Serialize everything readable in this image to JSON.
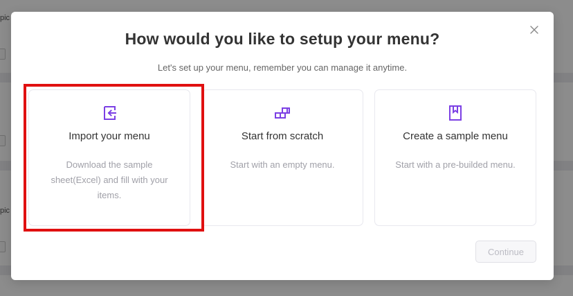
{
  "modal": {
    "title": "How would you like to setup your menu?",
    "subtitle": "Let's set up your menu, remember you can manage it anytime.",
    "close_icon": "close-icon",
    "options": [
      {
        "icon": "import-icon",
        "title": "Import your menu",
        "description": "Download the sample sheet(Excel) and fill with your items."
      },
      {
        "icon": "blocks-icon",
        "title": "Start from scratch",
        "description": "Start with an empty menu."
      },
      {
        "icon": "bookmark-icon",
        "title": "Create a sample menu",
        "description": "Start with a pre-builded menu."
      }
    ],
    "continue_label": "Continue",
    "accent_color": "#7b3fe4",
    "highlight_color": "#e01010"
  },
  "background": {
    "fragment_1": "pic",
    "fragment_2": "pic"
  }
}
